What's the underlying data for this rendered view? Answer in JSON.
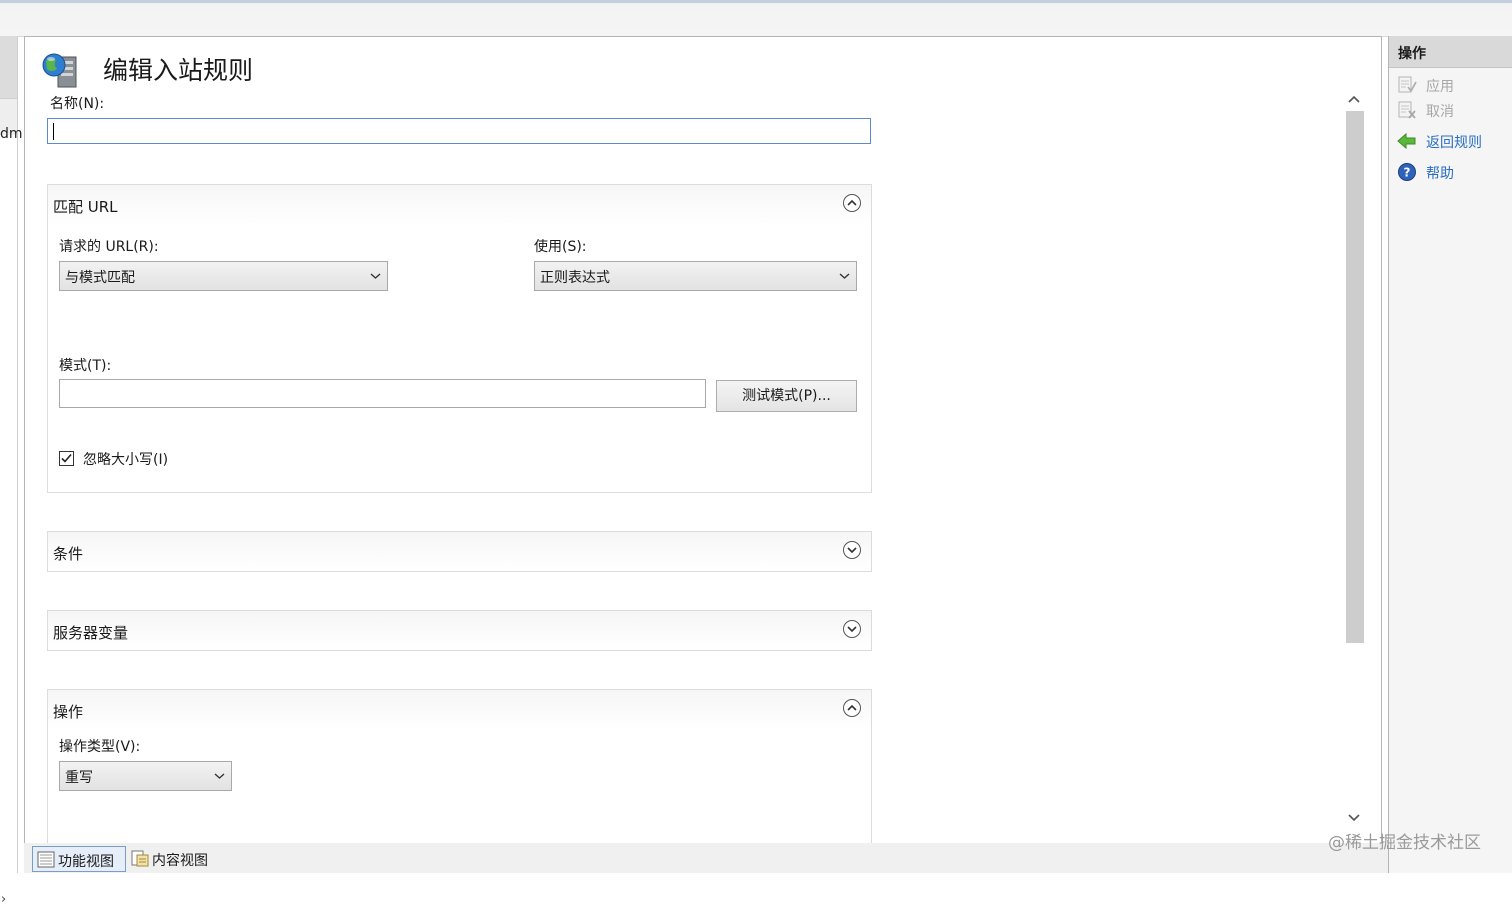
{
  "left_pane": {
    "cut_text": "dm",
    "expand_glyph": "›"
  },
  "page": {
    "title": "编辑入站规则",
    "title_icon": "server-globe-icon",
    "name_label": "名称(N):",
    "name_value": ""
  },
  "match_url": {
    "title": "匹配 URL",
    "requested_url_label": "请求的 URL(R):",
    "requested_url_value": "与模式匹配",
    "using_label": "使用(S):",
    "using_value": "正则表达式",
    "pattern_label": "模式(T):",
    "pattern_value": "",
    "test_button": "测试模式(P)...",
    "ignore_case_label": "忽略大小写(I)",
    "ignore_case_checked": true
  },
  "conditions": {
    "title": "条件"
  },
  "server_variables": {
    "title": "服务器变量"
  },
  "action": {
    "title": "操作",
    "action_type_label": "操作类型(V):",
    "action_type_value": "重写"
  },
  "actions_pane": {
    "title": "操作",
    "items": [
      {
        "label": "应用",
        "icon": "apply-icon",
        "enabled": false
      },
      {
        "label": "取消",
        "icon": "cancel-icon",
        "enabled": false
      },
      {
        "label": "返回规则",
        "icon": "back-arrow-icon",
        "enabled": true
      },
      {
        "label": "帮助",
        "icon": "help-icon",
        "enabled": true
      }
    ]
  },
  "bottom_tabs": {
    "features_view": "功能视图",
    "content_view": "内容视图",
    "active": "features_view"
  },
  "watermark": "@稀土掘金技术社区",
  "colors": {
    "link": "#2a6ec4",
    "disabled": "#a7a7a7",
    "focus_border": "#5b8cc9"
  }
}
